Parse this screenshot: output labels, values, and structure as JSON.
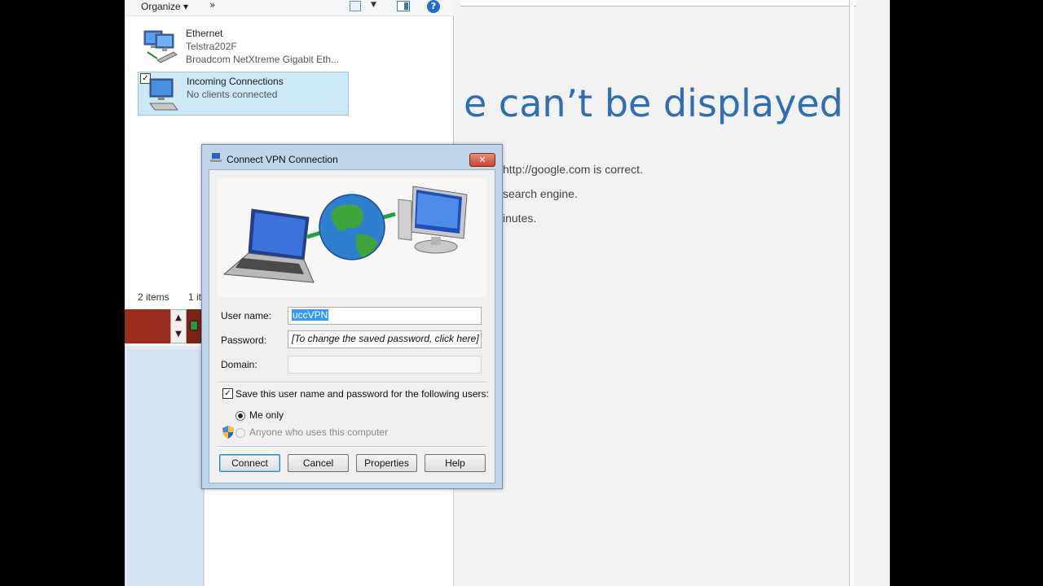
{
  "explorer": {
    "toolbar": {
      "organize": "Organize ▾",
      "more": "»"
    },
    "items": [
      {
        "name": "Ethernet",
        "sub1": "Telstra202F",
        "sub2": "Broadcom NetXtreme Gigabit Eth..."
      },
      {
        "name": "Incoming Connections",
        "sub1": "No clients connected",
        "sub2": ""
      }
    ],
    "status": {
      "count": "2 items",
      "selected": "1 it"
    }
  },
  "browser": {
    "error_title": "e can’t be displayed",
    "lines": [
      "http://google.com is correct.",
      "search engine.",
      "inutes."
    ]
  },
  "dialog": {
    "title": "Connect VPN Connection",
    "close": "✕",
    "username_label": "User name:",
    "username_value": "uccVPN",
    "password_label": "Password:",
    "password_value": "[To change the saved password, click here]",
    "domain_label": "Domain:",
    "domain_value": "",
    "save_label": "Save this user name and password for the following users:",
    "radio_me": "Me only",
    "radio_anyone": "Anyone who uses this computer",
    "buttons": {
      "connect": "Connect",
      "cancel": "Cancel",
      "properties": "Properties",
      "help": "Help"
    }
  },
  "colors": {
    "error_blue": "#2e6eb5",
    "taskbar_red": "#9b2b1f",
    "selection": "#cce8f5"
  },
  "icons": [
    "network-adapter-icon",
    "vpn-connection-icon",
    "help-icon",
    "shield-icon",
    "globe-icon",
    "laptop-icon",
    "monitor-icon"
  ]
}
